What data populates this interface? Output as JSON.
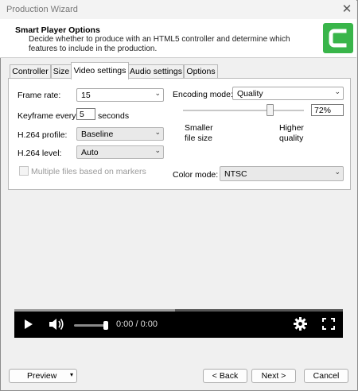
{
  "window": {
    "title": "Production Wizard"
  },
  "header": {
    "title": "Smart Player Options",
    "description": "Decide whether to produce with an HTML5 controller and determine which features to include in the production."
  },
  "tabs": [
    {
      "label": "Controller",
      "active": false
    },
    {
      "label": "Size",
      "active": false
    },
    {
      "label": "Video settings",
      "active": true
    },
    {
      "label": "Audio settings",
      "active": false
    },
    {
      "label": "Options",
      "active": false
    }
  ],
  "video_settings": {
    "frame_rate": {
      "label": "Frame rate:",
      "value": "15"
    },
    "keyframe": {
      "label": "Keyframe every:",
      "value": "5",
      "unit": "seconds"
    },
    "h264_profile": {
      "label": "H.264 profile:",
      "value": "Baseline"
    },
    "h264_level": {
      "label": "H.264 level:",
      "value": "Auto"
    },
    "multiple_files": {
      "label": "Multiple files based on markers",
      "checked": false,
      "enabled": false
    },
    "encoding_mode": {
      "label": "Encoding mode:",
      "value": "Quality"
    },
    "quality": {
      "value": "72%",
      "level": 0.72,
      "min_label": "Smaller\nfile size",
      "max_label": "Higher\nquality"
    },
    "color_mode": {
      "label": "Color mode:",
      "value": "NTSC"
    }
  },
  "video_player": {
    "time": "0:00 / 0:00",
    "progress": 0.49,
    "volume": 1.0
  },
  "footer": {
    "preview_label": "Preview",
    "back_label": "< Back",
    "next_label": "Next >",
    "cancel_label": "Cancel"
  },
  "colors": {
    "logo_green": "#39b54a",
    "player_bg": "#000000"
  },
  "icons": [
    "close-icon",
    "camtasia-logo",
    "play-icon",
    "volume-icon",
    "settings-gear-icon",
    "fullscreen-icon",
    "chevron-down-icon"
  ]
}
